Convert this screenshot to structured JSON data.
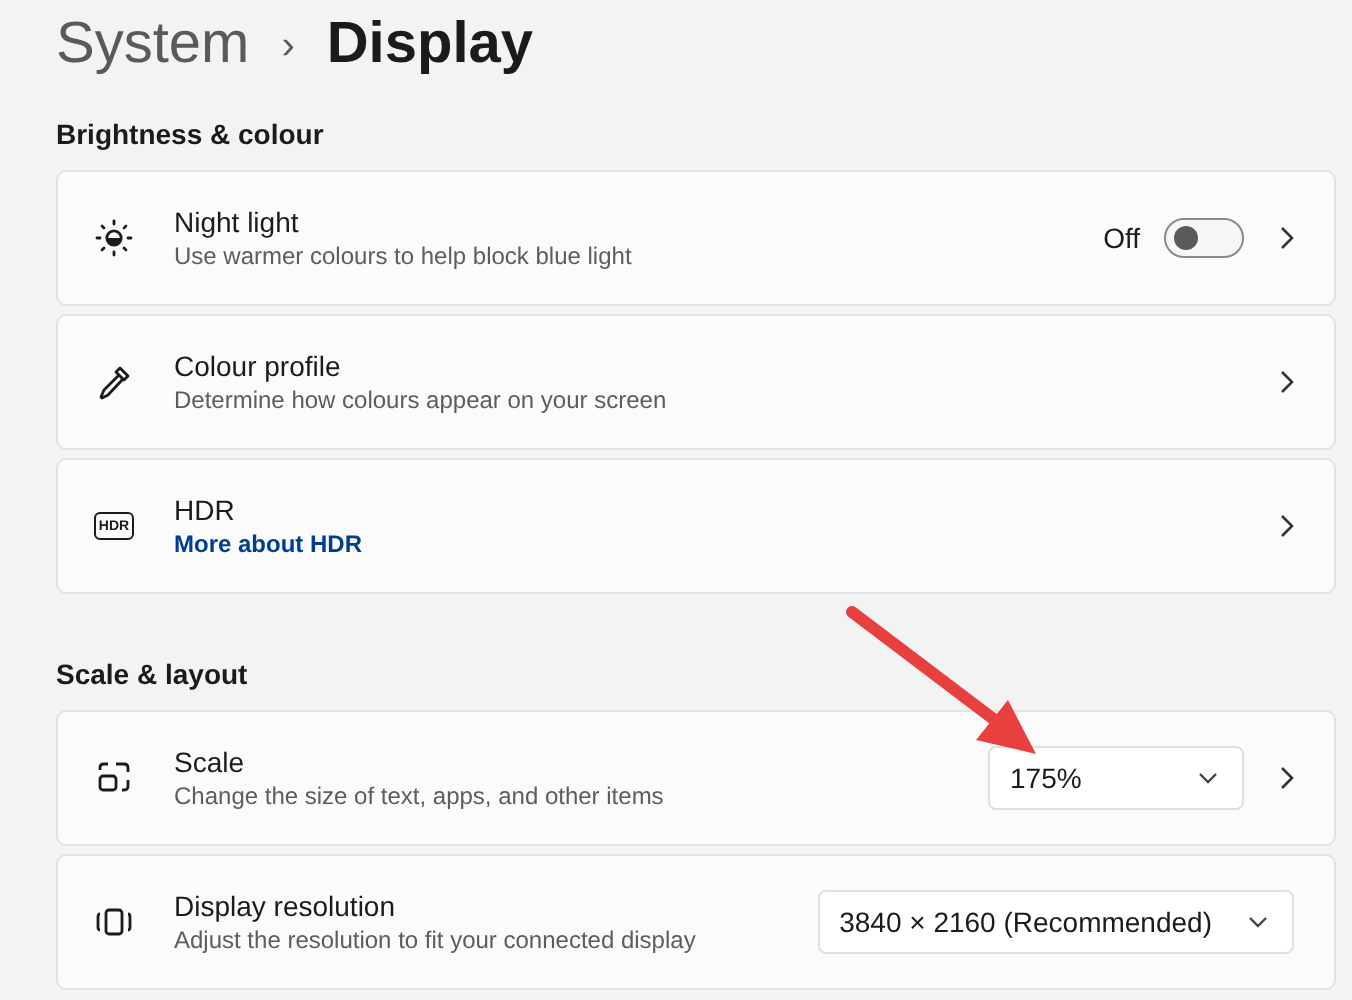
{
  "breadcrumb": {
    "parent": "System",
    "separator": "›",
    "current": "Display"
  },
  "sections": [
    {
      "title": "Brightness & colour",
      "rows": [
        {
          "title": "Night light",
          "subtitle": "Use warmer colours to help block blue light",
          "kind": "toggle",
          "toggle_label": "Off",
          "on": false,
          "chevron": true
        },
        {
          "title": "Colour profile",
          "subtitle": "Determine how colours appear on your screen",
          "kind": "plain",
          "chevron": true
        },
        {
          "icon_text": "HDR",
          "title": "HDR",
          "link": "More about HDR",
          "kind": "plain",
          "chevron": true
        }
      ]
    },
    {
      "title": "Scale & layout",
      "rows": [
        {
          "title": "Scale",
          "subtitle": "Change the size of text, apps, and other items",
          "kind": "dropdown",
          "value": "175%",
          "chevron": true
        },
        {
          "title": "Display resolution",
          "subtitle": "Adjust the resolution to fit your connected display",
          "kind": "dropdown",
          "value": "3840 × 2160 (Recommended)",
          "chevron": false
        }
      ]
    }
  ]
}
